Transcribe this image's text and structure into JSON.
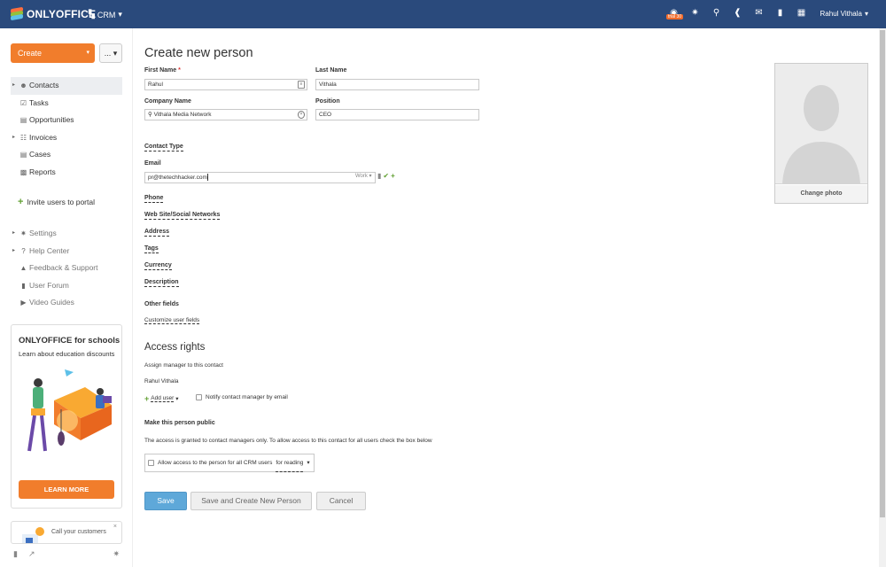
{
  "app": {
    "logo_text": "ONLYOFFICE",
    "module_label": "CRM",
    "trial_badge": "trial 30",
    "user_name": "Rahul Vithala"
  },
  "sidebar": {
    "create_label": "Create",
    "more_label": "...",
    "nav": [
      {
        "label": "Contacts",
        "icon": "contacts-icon",
        "expandable": true,
        "active": true
      },
      {
        "label": "Tasks",
        "icon": "tasks-icon",
        "expandable": false,
        "active": false
      },
      {
        "label": "Opportunities",
        "icon": "opportunities-icon",
        "expandable": false,
        "active": false
      },
      {
        "label": "Invoices",
        "icon": "invoices-icon",
        "expandable": true,
        "active": false
      },
      {
        "label": "Cases",
        "icon": "cases-icon",
        "expandable": false,
        "active": false
      },
      {
        "label": "Reports",
        "icon": "reports-icon",
        "expandable": false,
        "active": false
      }
    ],
    "invite_label": "Invite users to portal",
    "nav2": [
      {
        "label": "Settings",
        "icon": "gear-icon",
        "expandable": true
      },
      {
        "label": "Help Center",
        "icon": "help-icon",
        "expandable": true
      },
      {
        "label": "Feedback & Support",
        "icon": "megaphone-icon",
        "expandable": false
      },
      {
        "label": "User Forum",
        "icon": "forum-icon",
        "expandable": false
      },
      {
        "label": "Video Guides",
        "icon": "video-icon",
        "expandable": false
      }
    ],
    "promo": {
      "title": "ONLYOFFICE for schools",
      "subtitle": "Learn about education discounts",
      "button": "LEARN MORE"
    },
    "call_box": {
      "text": "Call your customers"
    }
  },
  "form": {
    "page_title": "Create new person",
    "first_name_label": "First Name",
    "first_name_required": "*",
    "first_name_value": "Rahul",
    "last_name_label": "Last Name",
    "last_name_value": "Vithala",
    "company_label": "Company Name",
    "company_value": "Vithala Media Network",
    "position_label": "Position",
    "position_value": "CEO",
    "contact_type_label": "Contact Type",
    "email_label": "Email",
    "email_value": "pr@thetechhacker.com",
    "email_type": "Work",
    "phone_label": "Phone",
    "website_label": "Web Site/Social Networks",
    "address_label": "Address",
    "tags_label": "Tags",
    "currency_label": "Currency",
    "description_label": "Description",
    "other_fields_label": "Other fields",
    "customize_label": "Customize user fields"
  },
  "access": {
    "title": "Access rights",
    "assign_label": "Assign manager to this contact",
    "manager_name": "Rahul Vithala",
    "add_user_label": "Add user",
    "notify_label": "Notify contact manager by email",
    "public_title": "Make this person public",
    "public_desc": "The access is granted to contact managers only. To allow access to this contact for all users check the box below",
    "allow_label": "Allow access to the person for all CRM users",
    "allow_mode": "for reading"
  },
  "buttons": {
    "save": "Save",
    "save_new": "Save and Create New Person",
    "cancel": "Cancel"
  },
  "photo": {
    "change_label": "Change photo"
  },
  "colors": {
    "topbar": "#2a4a7c",
    "accent_orange": "#f17d2c",
    "save_blue": "#5ea8d9",
    "add_green": "#63a135"
  }
}
